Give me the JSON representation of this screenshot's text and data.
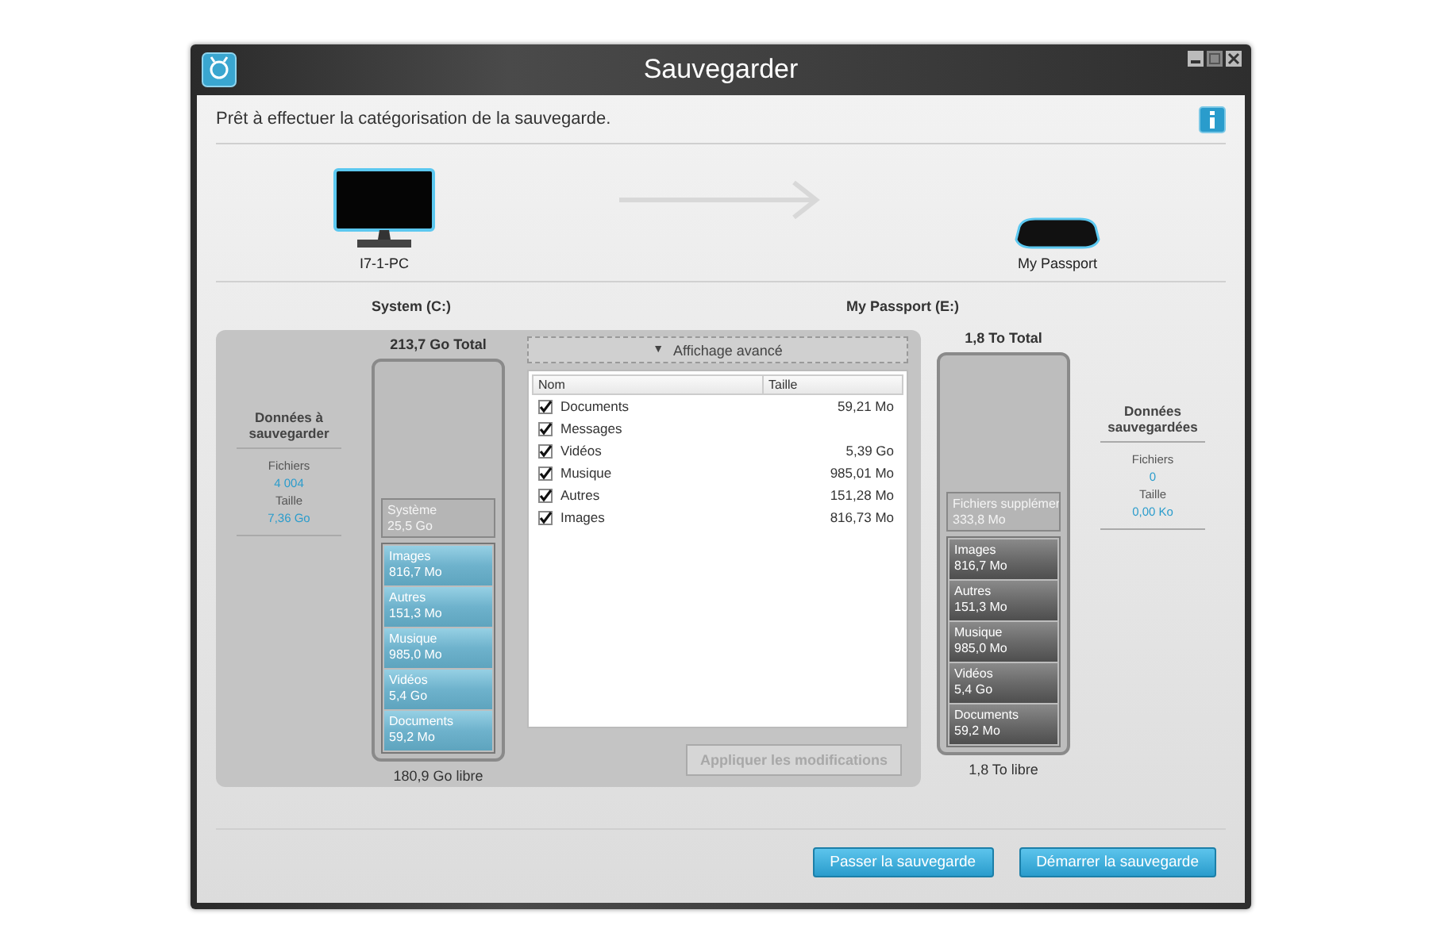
{
  "window": {
    "title": "Sauvegarder"
  },
  "status": "Prêt à effectuer la catégorisation de la sauvegarde.",
  "source": {
    "name": "I7-1-PC",
    "volume": "System (C:)"
  },
  "target": {
    "name": "My Passport",
    "volume": "My Passport (E:)"
  },
  "source_stats": {
    "heading": "Données à sauvegarder",
    "files_label": "Fichiers",
    "files": "4 004",
    "size_label": "Taille",
    "size": "7,36 Go"
  },
  "target_stats": {
    "heading": "Données sauvegardées",
    "files_label": "Fichiers",
    "files": "0",
    "size_label": "Taille",
    "size": "0,00 Ko"
  },
  "source_stack": {
    "total": "213,7 Go Total",
    "free": "180,9 Go libre",
    "segments": [
      {
        "kind": "other",
        "label": "Système",
        "value": "25,5 Go"
      },
      {
        "kind": "backup",
        "label": "Images",
        "value": "816,7 Mo"
      },
      {
        "kind": "backup",
        "label": "Autres",
        "value": "151,3 Mo"
      },
      {
        "kind": "backup",
        "label": "Musique",
        "value": "985,0 Mo"
      },
      {
        "kind": "backup",
        "label": "Vidéos",
        "value": "5,4 Go"
      },
      {
        "kind": "backup",
        "label": "Documents",
        "value": "59,2 Mo"
      }
    ]
  },
  "target_stack": {
    "total": "1,8 To Total",
    "free": "1,8 To libre",
    "segments": [
      {
        "kind": "other",
        "label": "Fichiers supplémer",
        "value": "333,8 Mo"
      },
      {
        "kind": "saved",
        "label": "Images",
        "value": "816,7 Mo"
      },
      {
        "kind": "saved",
        "label": "Autres",
        "value": "151,3 Mo"
      },
      {
        "kind": "saved",
        "label": "Musique",
        "value": "985,0 Mo"
      },
      {
        "kind": "saved",
        "label": "Vidéos",
        "value": "5,4 Go"
      },
      {
        "kind": "saved",
        "label": "Documents",
        "value": "59,2 Mo"
      }
    ]
  },
  "advanced": {
    "toggle": "▼",
    "label": "Affichage avancé",
    "columns": [
      "Nom",
      "Taille"
    ],
    "rows": [
      {
        "name": "Documents",
        "size": "59,21 Mo",
        "checked": true
      },
      {
        "name": "Messages",
        "checked": true
      },
      {
        "name": "Vidéos",
        "size": "5,39 Go",
        "checked": true
      },
      {
        "name": "Musique",
        "size": "985,01 Mo",
        "checked": true
      },
      {
        "name": "Autres",
        "size": "151,28 Mo",
        "checked": true
      },
      {
        "name": "Images",
        "size": "816,73 Mo",
        "checked": true
      }
    ],
    "apply": {
      "label": "Appliquer les modifications",
      "disabled": true
    }
  },
  "buttons": [
    "Passer la sauvegarde",
    "Démarrer la sauvegarde"
  ]
}
